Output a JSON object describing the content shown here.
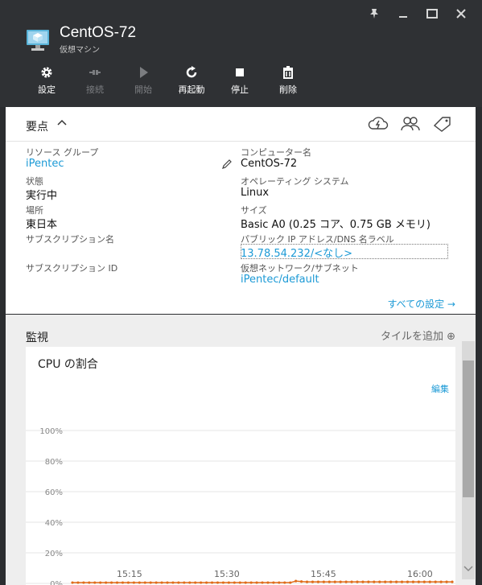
{
  "window": {
    "title": "CentOS-72",
    "subtitle": "仮想マシン",
    "controls": [
      "pin-icon",
      "minimize-icon",
      "maximize-icon",
      "close-icon"
    ]
  },
  "toolbar": {
    "items": [
      {
        "label": "設定",
        "icon": "gear-icon",
        "enabled": true
      },
      {
        "label": "接続",
        "icon": "connect-icon",
        "enabled": false
      },
      {
        "label": "開始",
        "icon": "play-icon",
        "enabled": false
      },
      {
        "label": "再起動",
        "icon": "restart-icon",
        "enabled": true
      },
      {
        "label": "停止",
        "icon": "stop-icon",
        "enabled": true
      },
      {
        "label": "削除",
        "icon": "trash-icon",
        "enabled": true
      }
    ]
  },
  "essentials": {
    "title": "要点",
    "right_icons": [
      "cloud-lightning-icon",
      "users-icon",
      "tag-icon"
    ],
    "properties": {
      "resource_group": {
        "label": "リソース グループ",
        "value": "iPentec"
      },
      "status": {
        "label": "状態",
        "value": "実行中"
      },
      "location": {
        "label": "場所",
        "value": "東日本"
      },
      "subscription": {
        "label": "サブスクリプション名",
        "value": ""
      },
      "subscription_id": {
        "label": "サブスクリプション ID",
        "value": ""
      },
      "computer_name": {
        "label": "コンピューター名",
        "value": "CentOS-72"
      },
      "os": {
        "label": "オペレーティング システム",
        "value": "Linux"
      },
      "size": {
        "label": "サイズ",
        "value": "Basic A0 (0.25 コア、0.75 GB メモリ)"
      },
      "public_ip": {
        "label": "パブリック IP アドレス/DNS 名ラベル",
        "value": "13.78.54.232/<なし>"
      },
      "vnet": {
        "label": "仮想ネットワーク/サブネット",
        "value": "iPentec/default"
      }
    },
    "all_settings": "すべての設定 →"
  },
  "monitoring": {
    "title": "監視",
    "add_tile": "タイルを追加 ⊕",
    "tile": {
      "title": "CPU の割合",
      "edit": "編集"
    }
  },
  "colors": {
    "accent": "#1c9ad6",
    "series": "#e06c1a"
  },
  "chart_data": {
    "type": "line",
    "title": "CPU の割合",
    "xlabel": "",
    "ylabel": "",
    "y_ticks": [
      "100%",
      "80%",
      "60%",
      "40%",
      "20%",
      "0%"
    ],
    "x_ticks": [
      "15:15",
      "15:30",
      "15:45",
      "16:00"
    ],
    "ylim": [
      0,
      100
    ],
    "grid": true,
    "series": [
      {
        "color": "#e06c1a",
        "values": [
          0.5,
          0.5,
          0.5,
          0.5,
          0.5,
          0.5,
          0.5,
          0.5,
          0.5,
          0.5,
          0.5,
          0.5,
          0.5,
          0.5,
          0.5,
          0.5,
          0.5,
          0.5,
          0.5,
          0.5,
          0.5,
          0.5,
          0.5,
          0.5,
          0.5,
          0.5,
          0.5,
          0.5,
          0.5,
          0.5,
          0.5,
          0.5,
          0.5,
          0.5,
          0.5,
          0.5,
          0.5,
          0.5,
          0.5,
          0.5,
          1.5,
          1.2,
          1.0,
          1.0,
          1.0,
          1.0,
          1.0,
          1.0,
          1.0,
          1.0,
          1.0,
          1.0,
          1.0,
          1.0,
          1.0,
          1.0,
          1.0,
          1.0,
          1.0,
          1.0,
          1.0,
          1.0,
          1.0,
          1.0,
          1.0,
          1.0,
          1.0,
          1.0,
          1.0
        ]
      }
    ]
  }
}
